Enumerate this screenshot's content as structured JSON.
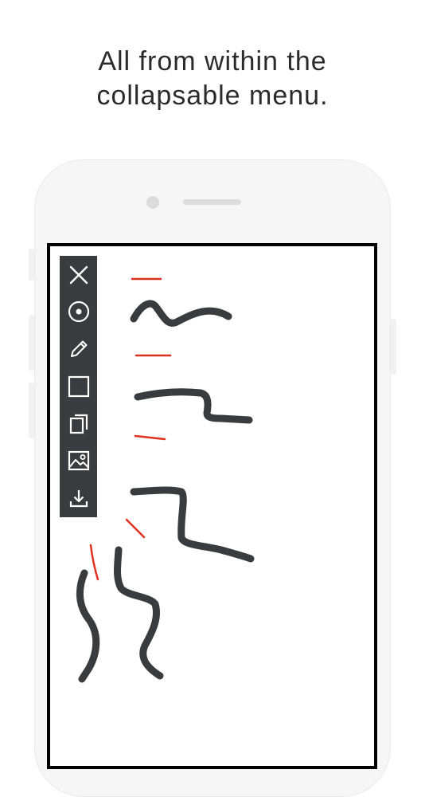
{
  "headline": {
    "line1": "All from within the",
    "line2": "collapsable menu."
  },
  "toolbar": {
    "tools": [
      {
        "icon": "close-icon"
      },
      {
        "icon": "target-icon"
      },
      {
        "icon": "pencil-icon"
      },
      {
        "icon": "square-icon"
      },
      {
        "icon": "copy-icon"
      },
      {
        "icon": "image-icon"
      },
      {
        "icon": "download-icon"
      }
    ]
  },
  "colors": {
    "background": "#ffffff",
    "phone_body": "#f6f6f6",
    "toolbar": "#3a3b3f",
    "toolbar_icon": "#ffffff",
    "stroke_dark": "#3a3b3f",
    "stroke_accent": "#e0301e"
  }
}
